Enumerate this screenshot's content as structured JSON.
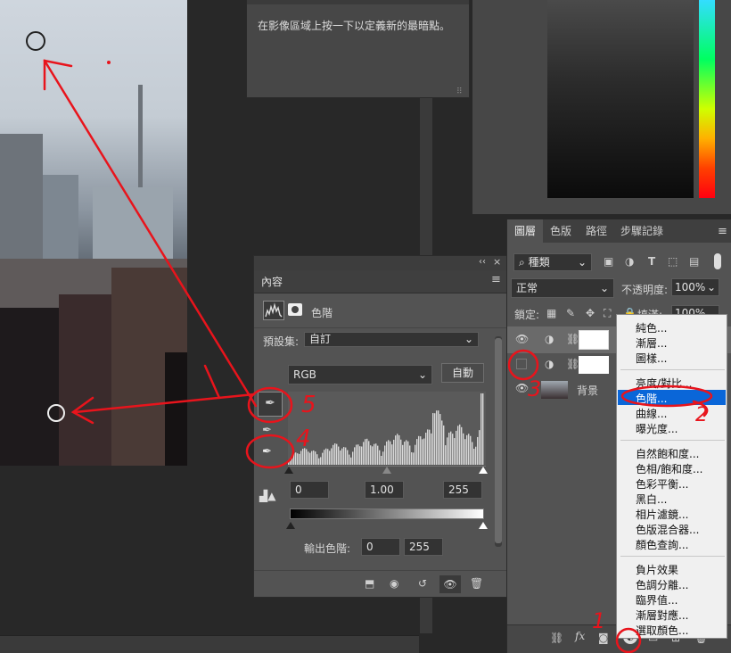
{
  "info_panel": {
    "text": "在影像區域上按一下以定義新的最暗點。"
  },
  "properties": {
    "tab": "內容",
    "adjustment_name": "色階",
    "preset_label": "預設集:",
    "preset_value": "自訂",
    "channel": "RGB",
    "auto_button": "自動",
    "input_black": "0",
    "input_gamma": "1.00",
    "input_white": "255",
    "output_label": "輸出色階:",
    "output_black": "0",
    "output_white": "255"
  },
  "layers": {
    "tabs": [
      "圖層",
      "色版",
      "路徑",
      "步驟記錄"
    ],
    "filter_kind": "種類",
    "blend_mode": "正常",
    "opacity_label": "不透明度:",
    "opacity_value": "100%",
    "lock_label": "鎖定:",
    "fill_label": "填滿:",
    "fill_value": "100%",
    "background_layer": "背景"
  },
  "menu": {
    "groups": [
      [
        "純色...",
        "漸層...",
        "圖樣..."
      ],
      [
        "亮度/對比...",
        "色階...",
        "曲線...",
        "曝光度..."
      ],
      [
        "自然飽和度...",
        "色相/飽和度...",
        "色彩平衡...",
        "黑白...",
        "相片濾鏡...",
        "色版混合器...",
        "顏色查詢..."
      ],
      [
        "負片效果",
        "色調分離...",
        "臨界值...",
        "漸層對應...",
        "選取顏色..."
      ]
    ],
    "selected": "色階..."
  },
  "annotations": [
    "1",
    "2",
    "3",
    "4",
    "5"
  ],
  "colors": {
    "annotation": "#e8141c",
    "selection": "#0a66d8",
    "panel": "#535353"
  }
}
